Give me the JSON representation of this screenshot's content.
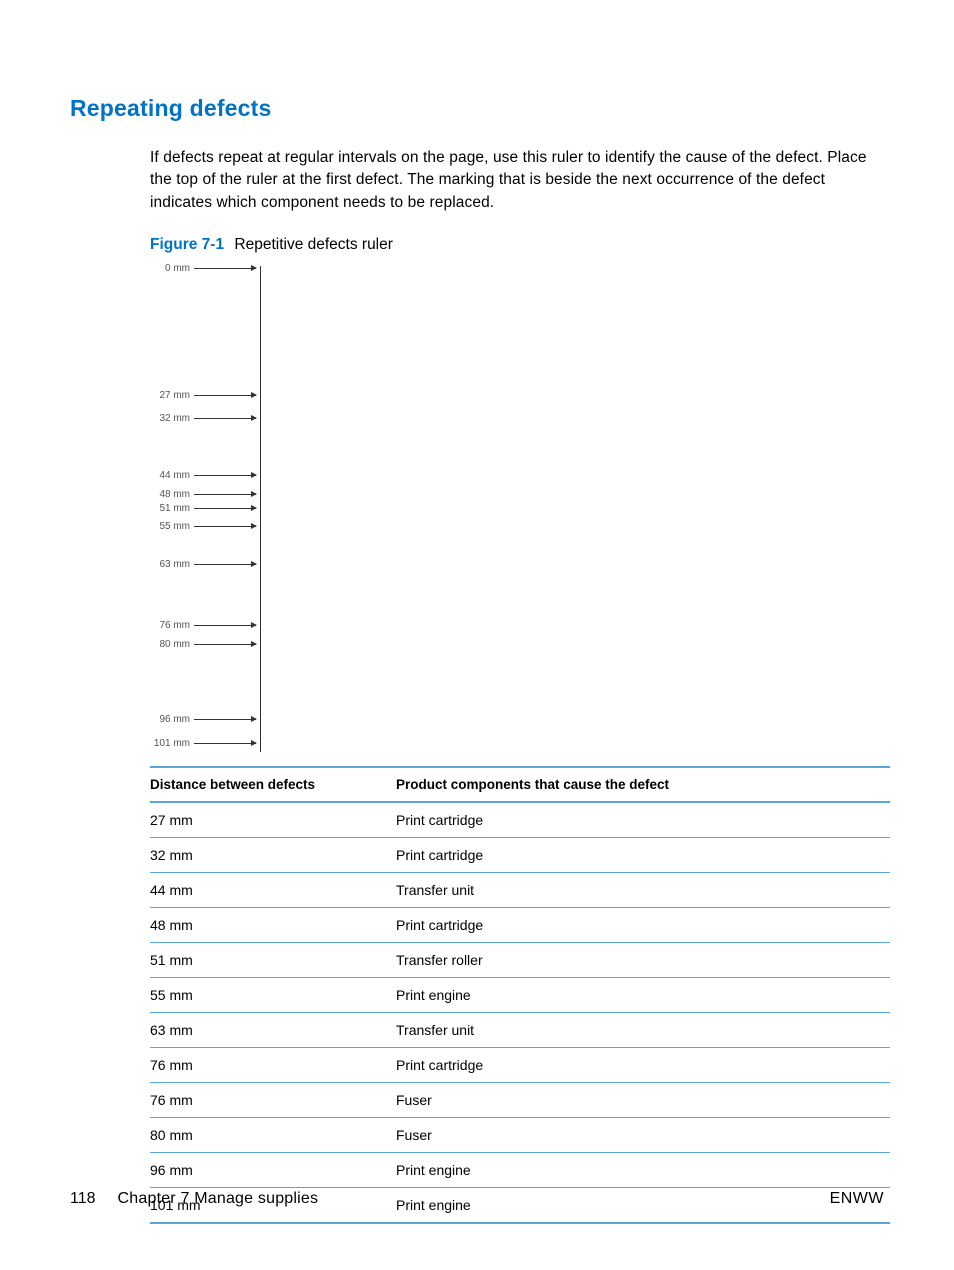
{
  "heading": "Repeating defects",
  "body": "If defects repeat at regular intervals on the page, use this ruler to identify the cause of the defect. Place the top of the ruler at the first defect. The marking that is beside the next occurrence of the defect indicates which component needs to be replaced.",
  "figure": {
    "label": "Figure 7-1",
    "caption": "Repetitive defects ruler"
  },
  "ruler_marks": [
    {
      "label": "0 mm",
      "mm": 0
    },
    {
      "label": "27 mm",
      "mm": 27
    },
    {
      "label": "32 mm",
      "mm": 32
    },
    {
      "label": "44 mm",
      "mm": 44
    },
    {
      "label": "48 mm",
      "mm": 48
    },
    {
      "label": "51 mm",
      "mm": 51
    },
    {
      "label": "55 mm",
      "mm": 55
    },
    {
      "label": "63 mm",
      "mm": 63
    },
    {
      "label": "76 mm",
      "mm": 76
    },
    {
      "label": "80 mm",
      "mm": 80
    },
    {
      "label": "96 mm",
      "mm": 96
    },
    {
      "label": "101 mm",
      "mm": 101
    }
  ],
  "table": {
    "headers": [
      "Distance between defects",
      "Product components that cause the defect"
    ],
    "rows": [
      [
        "27 mm",
        "Print cartridge"
      ],
      [
        "32 mm",
        "Print cartridge"
      ],
      [
        "44 mm",
        "Transfer unit"
      ],
      [
        "48 mm",
        "Print cartridge"
      ],
      [
        "51 mm",
        "Transfer roller"
      ],
      [
        "55 mm",
        "Print engine"
      ],
      [
        "63 mm",
        "Transfer unit"
      ],
      [
        "76 mm",
        "Print cartridge"
      ],
      [
        "76 mm",
        "Fuser"
      ],
      [
        "80 mm",
        "Fuser"
      ],
      [
        "96 mm",
        "Print engine"
      ],
      [
        "101 mm",
        "Print engine"
      ]
    ]
  },
  "footer": {
    "page_number": "118",
    "chapter": "Chapter 7   Manage supplies",
    "right": "ENWW"
  }
}
